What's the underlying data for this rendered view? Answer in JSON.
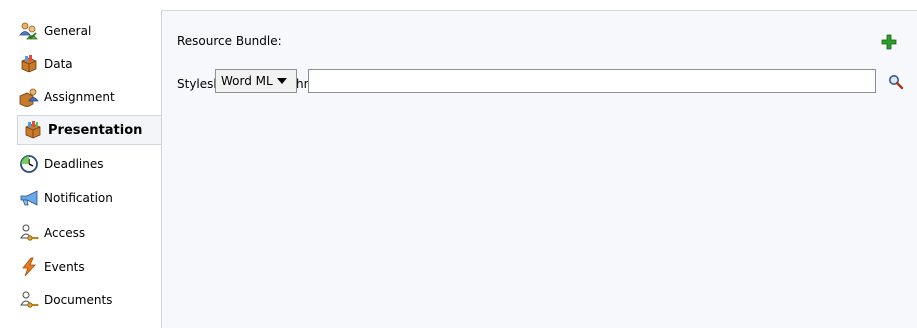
{
  "sidebar": {
    "items": [
      {
        "label": "General",
        "icon": "people-check-icon",
        "active": false
      },
      {
        "label": "Data",
        "icon": "data-box-icon",
        "active": false
      },
      {
        "label": "Assignment",
        "icon": "assignment-icon",
        "active": false
      },
      {
        "label": "Presentation",
        "icon": "presentation-box-icon",
        "active": true
      },
      {
        "label": "Deadlines",
        "icon": "clock-icon",
        "active": false
      },
      {
        "label": "Notification",
        "icon": "megaphone-icon",
        "active": false
      },
      {
        "label": "Access",
        "icon": "user-key-icon",
        "active": false
      },
      {
        "label": "Events",
        "icon": "lightning-icon",
        "active": false
      },
      {
        "label": "Documents",
        "icon": "user-key-icon",
        "active": false
      }
    ]
  },
  "form": {
    "resource_bundle_label": "Resource Bundle:",
    "stylesheet_label": "Stylesheet for Attachments:",
    "stylesheet_type_selected": "Word ML",
    "stylesheet_path_value": "",
    "add_icon": "plus-icon",
    "search_icon": "magnifier-icon"
  },
  "colors": {
    "accent_green": "#2c9e2c",
    "panel_bg": "#f6f8fb",
    "active_item_bg": "#f3f5f8",
    "border": "#d0d6de"
  }
}
